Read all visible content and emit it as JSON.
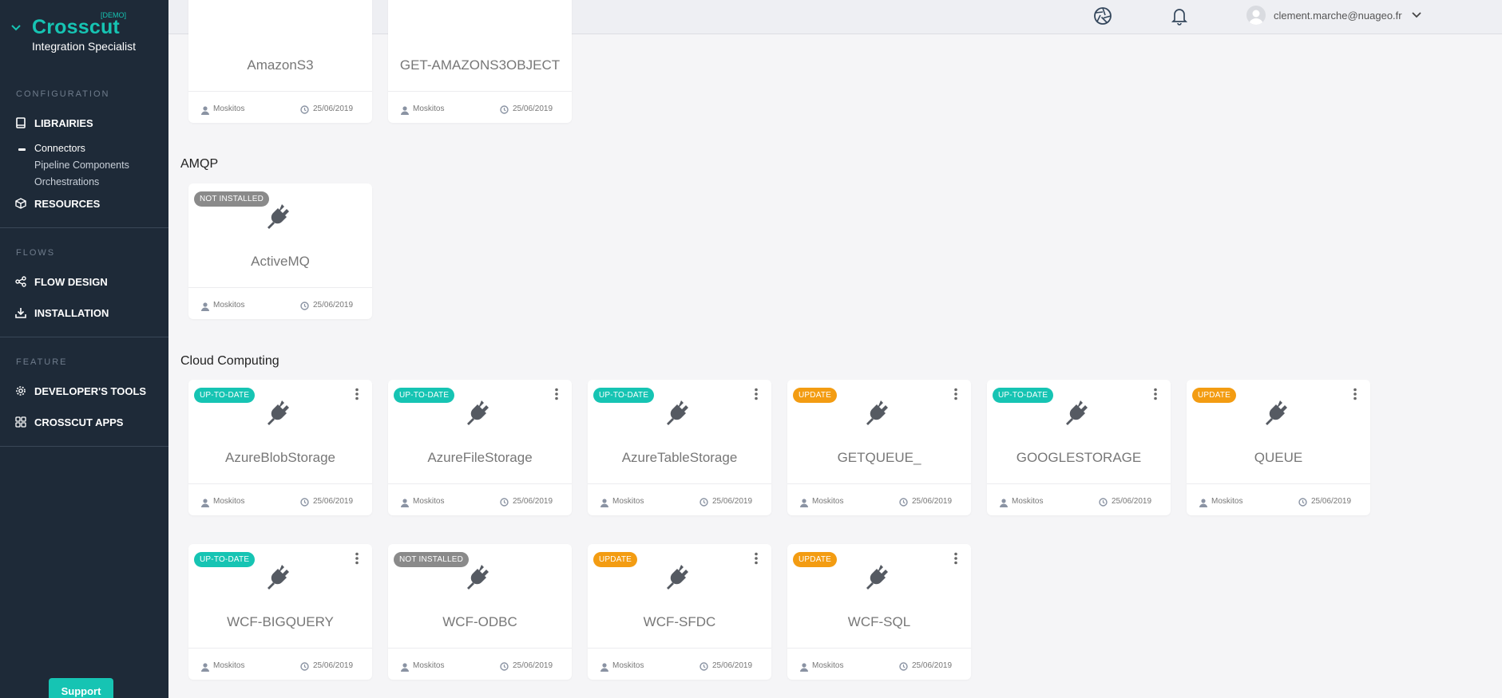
{
  "brand": {
    "demo": "[DEMO]",
    "name": "Crosscut",
    "subtitle": "Integration Specialist"
  },
  "sidebar": {
    "configuration_title": "CONFIGURATION",
    "libraries": "LIBRAIRIES",
    "connectors": "Connectors",
    "pipeline_components": "Pipeline Components",
    "orchestrations": "Orchestrations",
    "resources": "RESOURCES",
    "flows_title": "FLOWS",
    "flow_design": "FLOW DESIGN",
    "installation": "INSTALLATION",
    "feature_title": "FEATURE",
    "developer_tools": "DEVELOPER'S TOOLS",
    "crosscut_apps": "CROSSCUT APPS",
    "support": "Support"
  },
  "topbar": {
    "user_email": "clement.marche@nuageo.fr"
  },
  "colors": {
    "accent": "#16c4b3",
    "update": "#f39c12",
    "not_installed": "#8a8a8a",
    "sidebar_bg": "#1e2a38"
  },
  "groups": {
    "amqp": "AMQP",
    "cloud": "Cloud Computing"
  },
  "cards": [
    {
      "name": "AmazonS3",
      "badge": "",
      "author": "Moskitos",
      "date": "25/06/2019"
    },
    {
      "name": "GET-AMAZONS3OBJECT",
      "badge": "",
      "author": "Moskitos",
      "date": "25/06/2019"
    },
    {
      "name": "ActiveMQ",
      "badge": "NOT INSTALLED",
      "author": "Moskitos",
      "date": "25/06/2019"
    },
    {
      "name": "AzureBlobStorage",
      "badge": "UP-TO-DATE",
      "author": "Moskitos",
      "date": "25/06/2019"
    },
    {
      "name": "AzureFileStorage",
      "badge": "UP-TO-DATE",
      "author": "Moskitos",
      "date": "25/06/2019"
    },
    {
      "name": "AzureTableStorage",
      "badge": "UP-TO-DATE",
      "author": "Moskitos",
      "date": "25/06/2019"
    },
    {
      "name": "GETQUEUE_",
      "badge": "UPDATE",
      "author": "Moskitos",
      "date": "25/06/2019"
    },
    {
      "name": "GOOGLESTORAGE",
      "badge": "UP-TO-DATE",
      "author": "Moskitos",
      "date": "25/06/2019"
    },
    {
      "name": "QUEUE",
      "badge": "UPDATE",
      "author": "Moskitos",
      "date": "25/06/2019"
    },
    {
      "name": "WCF-BIGQUERY",
      "badge": "UP-TO-DATE",
      "author": "Moskitos",
      "date": "25/06/2019"
    },
    {
      "name": "WCF-ODBC",
      "badge": "NOT INSTALLED",
      "author": "Moskitos",
      "date": "25/06/2019"
    },
    {
      "name": "WCF-SFDC",
      "badge": "UPDATE",
      "author": "Moskitos",
      "date": "25/06/2019"
    },
    {
      "name": "WCF-SQL",
      "badge": "UPDATE",
      "author": "Moskitos",
      "date": "25/06/2019"
    }
  ]
}
